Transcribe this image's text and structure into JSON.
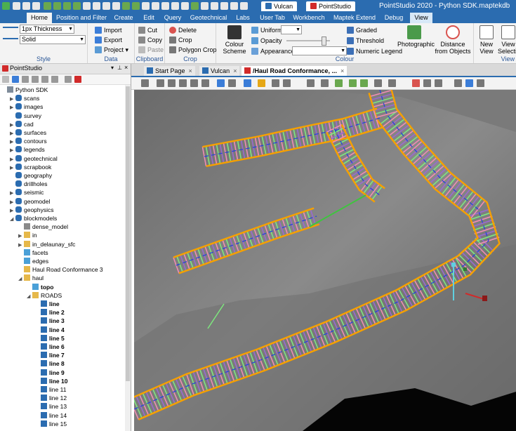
{
  "title_bar": {
    "context_tabs": [
      {
        "label": "Vulcan",
        "color": "#2b6cb0",
        "active": false
      },
      {
        "label": "PointStudio",
        "color": "#d12a2a",
        "active": true
      }
    ],
    "app_title": "PointStudio 2020 - Python SDK.maptekdb"
  },
  "ribbon_tabs": [
    "Home",
    "Position and Filter",
    "Create",
    "Edit",
    "Query",
    "Geotechnical",
    "Labs",
    "User Tab",
    "Workbench",
    "Maptek Extend",
    "Debug",
    "View"
  ],
  "ribbon": {
    "style": {
      "thickness": "1px Thickness",
      "line_style": "Solid",
      "label": "Style"
    },
    "data": {
      "import": "Import",
      "export": "Export",
      "project": "Project",
      "label": "Data"
    },
    "clipboard": {
      "cut": "Cut",
      "copy": "Copy",
      "paste": "Paste",
      "label": "Clipboard"
    },
    "crop": {
      "delete": "Delete",
      "crop": "Crop",
      "polygon_crop": "Polygon Crop",
      "label": "Crop"
    },
    "colour": {
      "scheme": "Colour Scheme",
      "uniform": "Uniform",
      "opacity": "Opacity",
      "appearance": "Appearance",
      "graded": "Graded",
      "threshold": "Threshold",
      "numeric_legend": "Numeric Legend",
      "photographic": "Photographic",
      "distance": "Distance from Objects",
      "label": "Colour"
    },
    "view": {
      "new_view": "New View",
      "view_selection": "View Selection",
      "label": "View"
    }
  },
  "panel": {
    "title": "PointStudio",
    "tree": [
      {
        "label": "Python SDK",
        "depth": 0,
        "arrow": "",
        "icon": "db",
        "bold": false
      },
      {
        "label": "scans",
        "depth": 1,
        "arrow": "▶",
        "icon": "cyl",
        "bold": false
      },
      {
        "label": "images",
        "depth": 1,
        "arrow": "▶",
        "icon": "cyl",
        "bold": false
      },
      {
        "label": "survey",
        "depth": 1,
        "arrow": "",
        "icon": "cyl",
        "bold": false
      },
      {
        "label": "cad",
        "depth": 1,
        "arrow": "▶",
        "icon": "cyl",
        "bold": false
      },
      {
        "label": "surfaces",
        "depth": 1,
        "arrow": "▶",
        "icon": "cyl",
        "bold": false
      },
      {
        "label": "contours",
        "depth": 1,
        "arrow": "▶",
        "icon": "cyl",
        "bold": false
      },
      {
        "label": "legends",
        "depth": 1,
        "arrow": "▶",
        "icon": "cyl",
        "bold": false
      },
      {
        "label": "geotechnical",
        "depth": 1,
        "arrow": "▶",
        "icon": "cyl",
        "bold": false
      },
      {
        "label": "scrapbook",
        "depth": 1,
        "arrow": "▶",
        "icon": "cyl",
        "bold": false
      },
      {
        "label": "geography",
        "depth": 1,
        "arrow": "",
        "icon": "cyl",
        "bold": false
      },
      {
        "label": "drillholes",
        "depth": 1,
        "arrow": "",
        "icon": "cyl",
        "bold": false
      },
      {
        "label": "seismic",
        "depth": 1,
        "arrow": "▶",
        "icon": "cyl",
        "bold": false
      },
      {
        "label": "geomodel",
        "depth": 1,
        "arrow": "▶",
        "icon": "cyl",
        "bold": false
      },
      {
        "label": "geophysics",
        "depth": 1,
        "arrow": "▶",
        "icon": "cyl",
        "bold": false
      },
      {
        "label": "blockmodels",
        "depth": 1,
        "arrow": "◢",
        "icon": "cyl",
        "bold": false
      },
      {
        "label": "dense_model",
        "depth": 2,
        "arrow": "",
        "icon": "block",
        "bold": false
      },
      {
        "label": "in",
        "depth": 2,
        "arrow": "▶",
        "icon": "folder",
        "bold": false
      },
      {
        "label": "in_delaunay_sfc",
        "depth": 2,
        "arrow": "▶",
        "icon": "folder",
        "bold": false
      },
      {
        "label": "facets",
        "depth": 2,
        "arrow": "",
        "icon": "facet",
        "bold": false
      },
      {
        "label": "edges",
        "depth": 2,
        "arrow": "",
        "icon": "edge",
        "bold": false
      },
      {
        "label": "Haul Road Conformance 3",
        "depth": 2,
        "arrow": "",
        "icon": "folder",
        "bold": false
      },
      {
        "label": "haul",
        "depth": 2,
        "arrow": "◢",
        "icon": "folder",
        "bold": false
      },
      {
        "label": "topo",
        "depth": 3,
        "arrow": "",
        "icon": "surf",
        "bold": true
      },
      {
        "label": "ROADS",
        "depth": 3,
        "arrow": "◢",
        "icon": "folder",
        "bold": false
      },
      {
        "label": "line",
        "depth": 4,
        "arrow": "",
        "icon": "line",
        "bold": true
      },
      {
        "label": "line 2",
        "depth": 4,
        "arrow": "",
        "icon": "line",
        "bold": true
      },
      {
        "label": "line 3",
        "depth": 4,
        "arrow": "",
        "icon": "line",
        "bold": true
      },
      {
        "label": "line 4",
        "depth": 4,
        "arrow": "",
        "icon": "line",
        "bold": true
      },
      {
        "label": "line 5",
        "depth": 4,
        "arrow": "",
        "icon": "line",
        "bold": true
      },
      {
        "label": "line 6",
        "depth": 4,
        "arrow": "",
        "icon": "line",
        "bold": true
      },
      {
        "label": "line 7",
        "depth": 4,
        "arrow": "",
        "icon": "line",
        "bold": true
      },
      {
        "label": "line 8",
        "depth": 4,
        "arrow": "",
        "icon": "line",
        "bold": true
      },
      {
        "label": "line 9",
        "depth": 4,
        "arrow": "",
        "icon": "line",
        "bold": true
      },
      {
        "label": "line 10",
        "depth": 4,
        "arrow": "",
        "icon": "line",
        "bold": true
      },
      {
        "label": "line 11",
        "depth": 4,
        "arrow": "",
        "icon": "line",
        "bold": false
      },
      {
        "label": "line 12",
        "depth": 4,
        "arrow": "",
        "icon": "line",
        "bold": false
      },
      {
        "label": "line 13",
        "depth": 4,
        "arrow": "",
        "icon": "line",
        "bold": false
      },
      {
        "label": "line 14",
        "depth": 4,
        "arrow": "",
        "icon": "line",
        "bold": false
      },
      {
        "label": "line 15",
        "depth": 4,
        "arrow": "",
        "icon": "line",
        "bold": false
      }
    ]
  },
  "doc_tabs": [
    {
      "label": "Start Page",
      "icon": "home",
      "active": false
    },
    {
      "label": "Vulcan",
      "icon": "vulcan",
      "active": false
    },
    {
      "label": "/Haul Road Conformance, ...",
      "icon": "ps",
      "active": true
    }
  ],
  "colors": {
    "accent": "#2b6cb0",
    "road_edge": "#f5a000",
    "stripe_green": "#7ee87e",
    "stripe_pink": "#f08cb4",
    "stripe_purple": "#9a6ad0",
    "center_blue": "#2040e0",
    "center_red": "#e02020"
  }
}
